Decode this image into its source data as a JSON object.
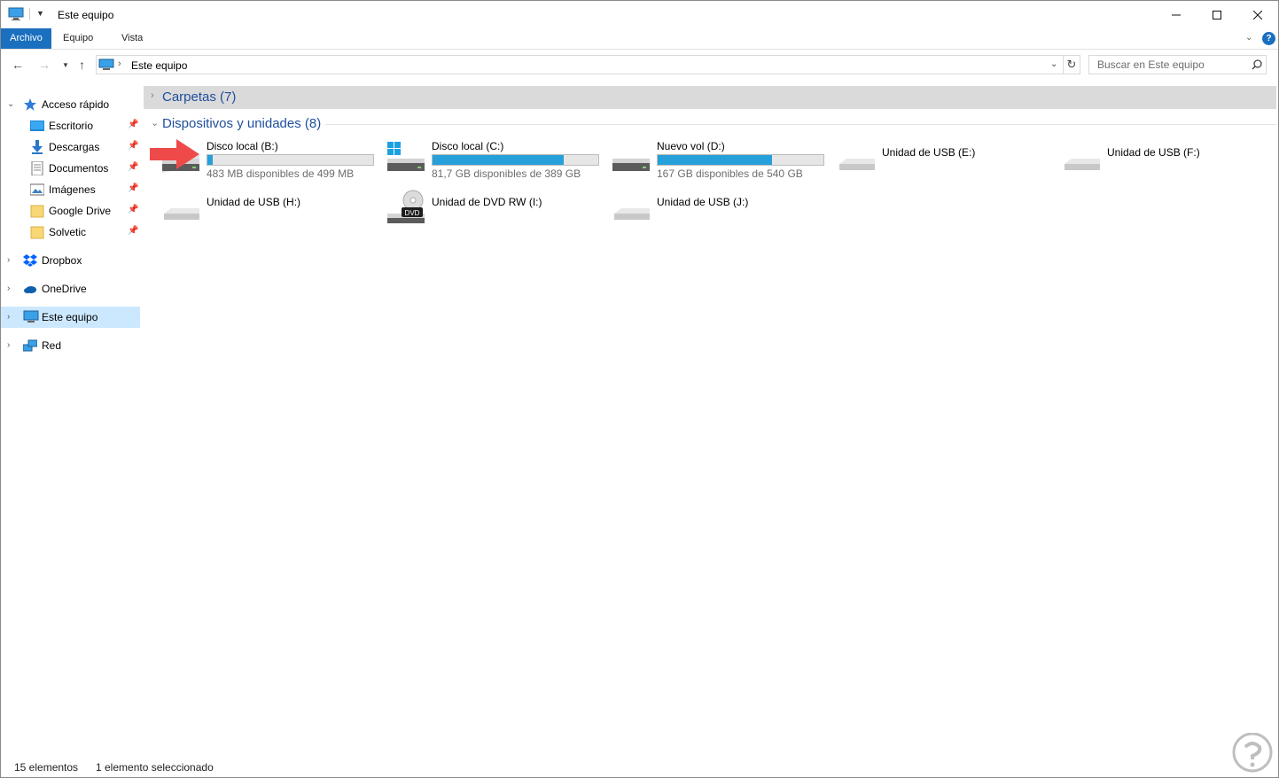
{
  "window": {
    "title": "Este equipo",
    "controls": {
      "minimize": "—",
      "maximize": "☐",
      "close": "✕"
    }
  },
  "ribbon": {
    "tabs": [
      {
        "label": "Archivo"
      },
      {
        "label": "Equipo"
      },
      {
        "label": "Vista"
      }
    ],
    "help": "?"
  },
  "navigation": {
    "breadcrumb": "Este equipo",
    "search_placeholder": "Buscar en Este equipo"
  },
  "sidebar": {
    "quick_access": {
      "label": "Acceso rápido",
      "items": [
        {
          "label": "Escritorio",
          "icon": "desktop-icon",
          "pinned": true
        },
        {
          "label": "Descargas",
          "icon": "download-icon",
          "pinned": true
        },
        {
          "label": "Documentos",
          "icon": "document-icon",
          "pinned": true
        },
        {
          "label": "Imágenes",
          "icon": "pictures-icon",
          "pinned": true
        },
        {
          "label": "Google Drive",
          "icon": "folder-icon",
          "pinned": true
        },
        {
          "label": "Solvetic",
          "icon": "folder-icon",
          "pinned": true
        }
      ]
    },
    "roots": [
      {
        "label": "Dropbox",
        "icon": "dropbox-icon"
      },
      {
        "label": "OneDrive",
        "icon": "onedrive-icon"
      },
      {
        "label": "Este equipo",
        "icon": "computer-icon",
        "selected": true
      },
      {
        "label": "Red",
        "icon": "network-icon"
      }
    ]
  },
  "content": {
    "groups": {
      "folders": {
        "title": "Carpetas (7)",
        "collapsed": true
      },
      "devices": {
        "title": "Dispositivos y unidades (8)",
        "collapsed": false
      }
    },
    "drives": [
      {
        "name": "Disco local (B:)",
        "info": "483 MB disponibles de 499 MB",
        "used_fraction": 0.03,
        "icon": "hard-drive-icon"
      },
      {
        "name": "Disco local (C:)",
        "info": "81,7 GB disponibles de 389 GB",
        "used_fraction": 0.79,
        "icon": "system-drive-icon"
      },
      {
        "name": "Nuevo vol (D:)",
        "info": "167 GB disponibles de 540 GB",
        "used_fraction": 0.69,
        "icon": "hard-drive-icon"
      },
      {
        "name": "Unidad de USB (E:)",
        "icon": "usb-drive-icon"
      },
      {
        "name": "Unidad de USB (F:)",
        "icon": "usb-drive-icon"
      },
      {
        "name": "Unidad de USB (H:)",
        "icon": "usb-drive-icon"
      },
      {
        "name": "Unidad de DVD RW (I:)",
        "icon": "dvd-drive-icon",
        "badge": "DVD"
      },
      {
        "name": "Unidad de USB (J:)",
        "icon": "usb-drive-icon"
      }
    ]
  },
  "status": {
    "item_count": "15 elementos",
    "selection": "1 elemento seleccionado"
  },
  "colors": {
    "accent": "#1a6fbf",
    "drive_bar": "#26a0da",
    "selection": "#cce8ff",
    "group_title": "#1f4e9c",
    "pointer_arrow": "#ef4a4a"
  }
}
